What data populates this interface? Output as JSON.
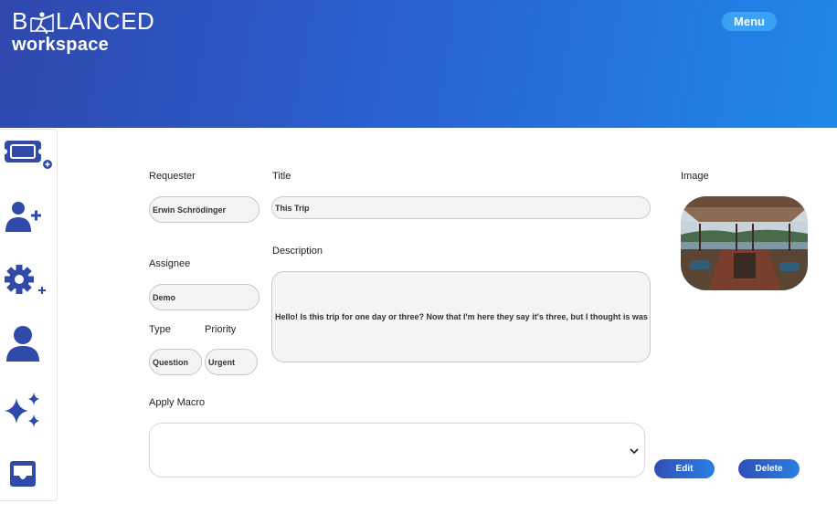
{
  "header": {
    "logo_pre": "B",
    "logo_post": "LANCED",
    "logo_sub": "workspace",
    "menu_label": "Menu"
  },
  "sidebar": {
    "items": [
      {
        "icon": "new-ticket-icon"
      },
      {
        "icon": "add-user-icon"
      },
      {
        "icon": "add-settings-icon"
      },
      {
        "icon": "user-icon"
      },
      {
        "icon": "sparkles-icon"
      },
      {
        "icon": "inbox-icon"
      }
    ]
  },
  "form": {
    "requester_label": "Requester",
    "requester_value": "Erwin Schrödinger",
    "title_label": "Title",
    "title_value": "This Trip",
    "image_label": "Image",
    "assignee_label": "Assignee",
    "assignee_value": "Demo",
    "description_label": "Description",
    "description_value": "Hello! Is this trip for one day or three? Now that I'm here they say it's three, but I thought is was",
    "type_label": "Type",
    "type_value": "Question",
    "priority_label": "Priority",
    "priority_value": "Urgent",
    "macro_label": "Apply Macro",
    "macro_value": "",
    "edit_label": "Edit",
    "delete_label": "Delete"
  },
  "colors": {
    "brand_blue": "#2f48ad",
    "accent_light": "#3aa2f3",
    "icon_blue": "#2f4aa8"
  }
}
